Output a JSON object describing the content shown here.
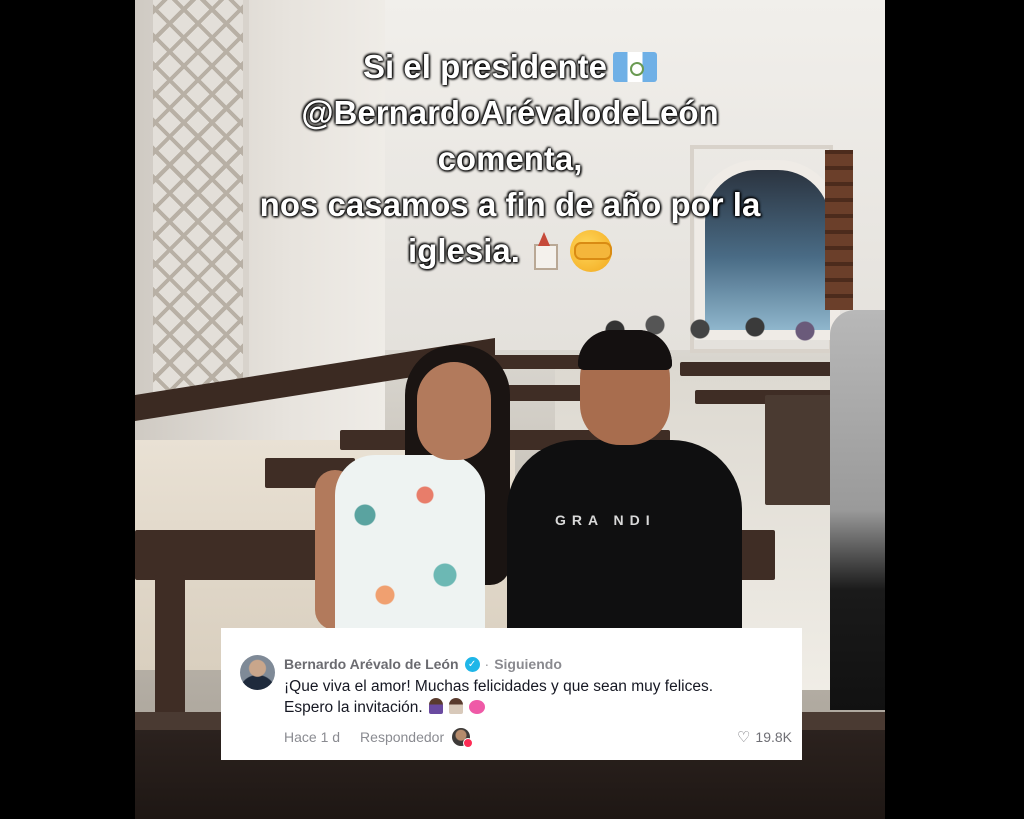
{
  "caption": {
    "line1": "Si el presidente",
    "line2": "@BernardoArévalodeLeón",
    "line3": "comenta,",
    "line4": "nos casamos a fin de año por la",
    "line5": "iglesia.",
    "icons": [
      "guatemala-flag-icon",
      "church-icon",
      "face-peeking-icon"
    ]
  },
  "comment": {
    "author": "Bernardo Arévalo de León",
    "separator": "·",
    "follow_status": "Siguiendo",
    "text": "¡Que viva el amor! Muchas felicidades y que sean muy felices. Espero la invitación.",
    "time": "Hace 1 d",
    "reply_label": "Respondedor",
    "likes": "19.8K",
    "icons": [
      "verified-icon",
      "heart-icon",
      "creator-avatar-icon"
    ],
    "colors": {
      "verified": "#1fb6e8",
      "creator_badge": "#fe2c55"
    }
  },
  "photo": {
    "shirt_text": "GRA NDI"
  }
}
